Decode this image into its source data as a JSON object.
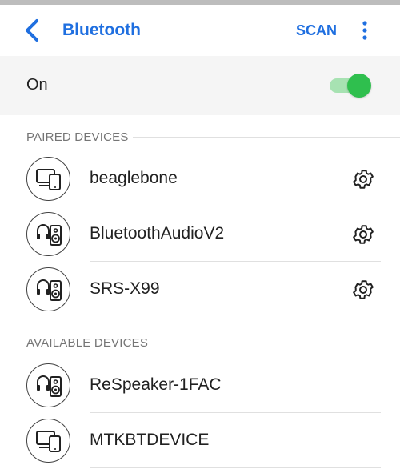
{
  "header": {
    "title": "Bluetooth",
    "scan_label": "SCAN",
    "back_icon": "back-arrow-icon",
    "more_icon": "more-vert-icon",
    "accent_color": "#1f6fe0"
  },
  "bluetooth_toggle": {
    "label": "On",
    "enabled": true,
    "track_color": "#a7e2b2",
    "thumb_color": "#2fbf4e"
  },
  "paired": {
    "section_title": "PAIRED DEVICES",
    "devices": [
      {
        "name": "beaglebone",
        "icon": "phone-laptop-icon",
        "settings_icon": "gear-icon"
      },
      {
        "name": "BluetoothAudioV2",
        "icon": "headphones-speaker-icon",
        "settings_icon": "gear-icon"
      },
      {
        "name": "SRS-X99",
        "icon": "headphones-speaker-icon",
        "settings_icon": "gear-icon"
      }
    ]
  },
  "available": {
    "section_title": "AVAILABLE DEVICES",
    "devices": [
      {
        "name": "ReSpeaker-1FAC",
        "icon": "headphones-speaker-icon"
      },
      {
        "name": "MTKBTDEVICE",
        "icon": "phone-laptop-icon"
      }
    ]
  }
}
